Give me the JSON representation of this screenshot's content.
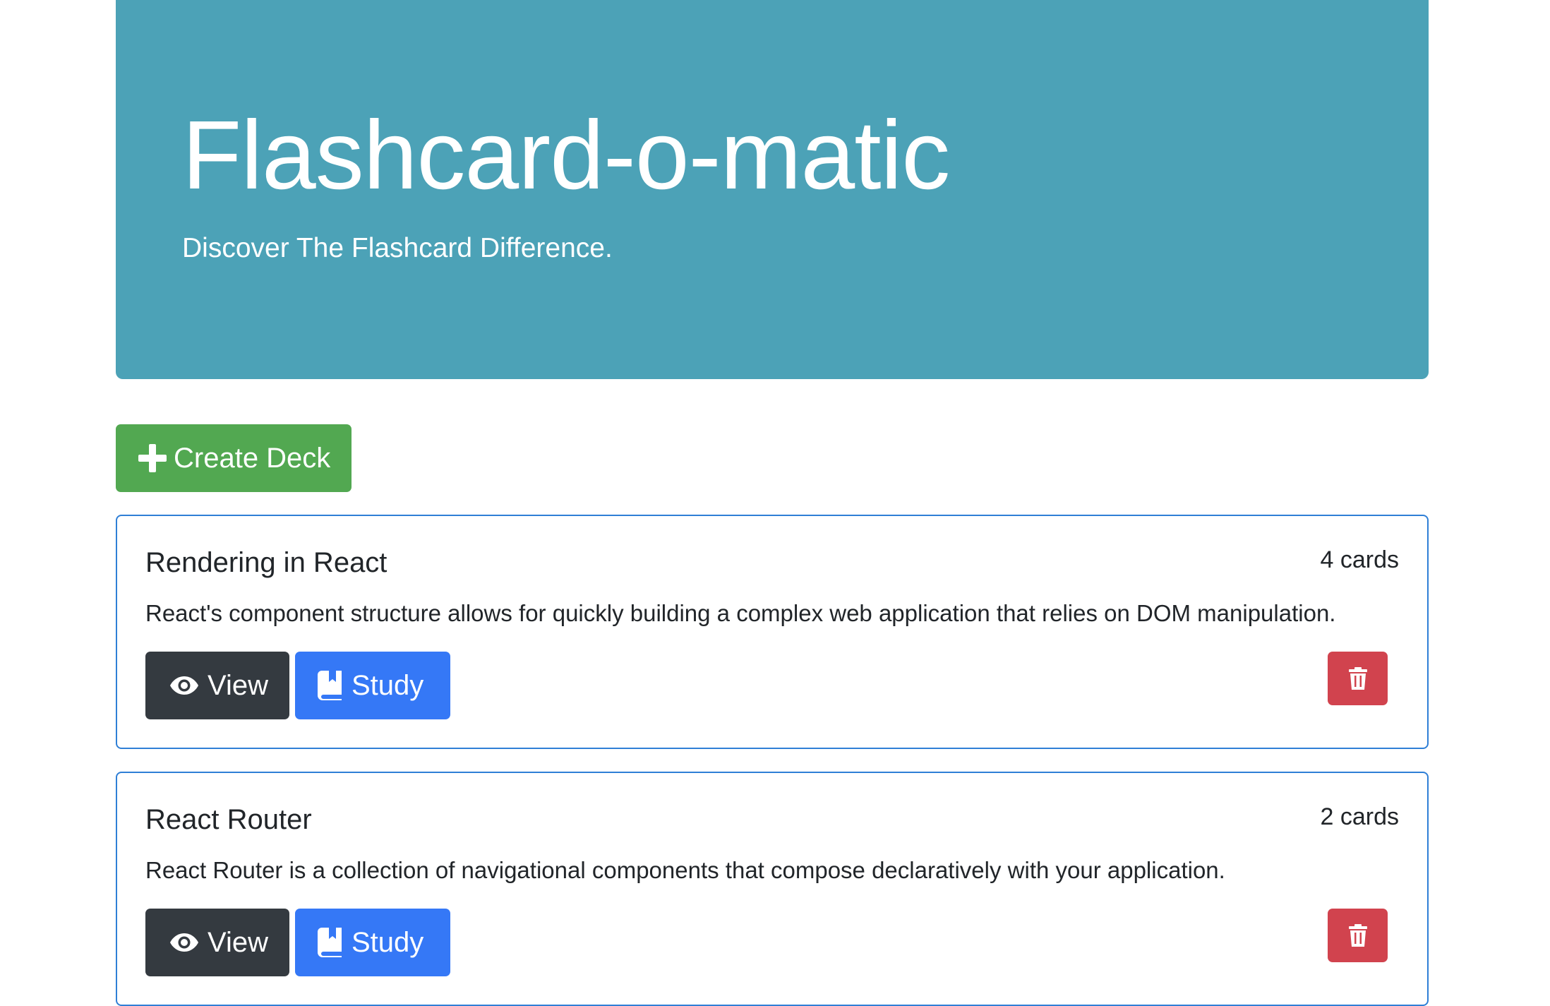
{
  "header": {
    "title": "Flashcard-o-matic",
    "subtitle": "Discover The Flashcard Difference."
  },
  "actions": {
    "create_deck_label": "Create Deck"
  },
  "decks": [
    {
      "name": "Rendering in React",
      "count": "4 cards",
      "description": "React's component structure allows for quickly building a complex web application that relies on DOM manipulation.",
      "view_label": "View",
      "study_label": "Study"
    },
    {
      "name": "React Router",
      "count": "2 cards",
      "description": "React Router is a collection of navigational components that compose declaratively with your application.",
      "view_label": "View",
      "study_label": "Study"
    }
  ],
  "icons": {
    "create": "plus-icon",
    "view": "eye-icon",
    "study": "book-icon",
    "delete": "trash-icon"
  },
  "colors": {
    "jumbotron": "#4ca2b7",
    "create_button": "#52a851",
    "view_button": "#343a40",
    "study_button": "#3578f6",
    "delete_button": "#d1434e",
    "deck_border": "#2f7fd6"
  }
}
